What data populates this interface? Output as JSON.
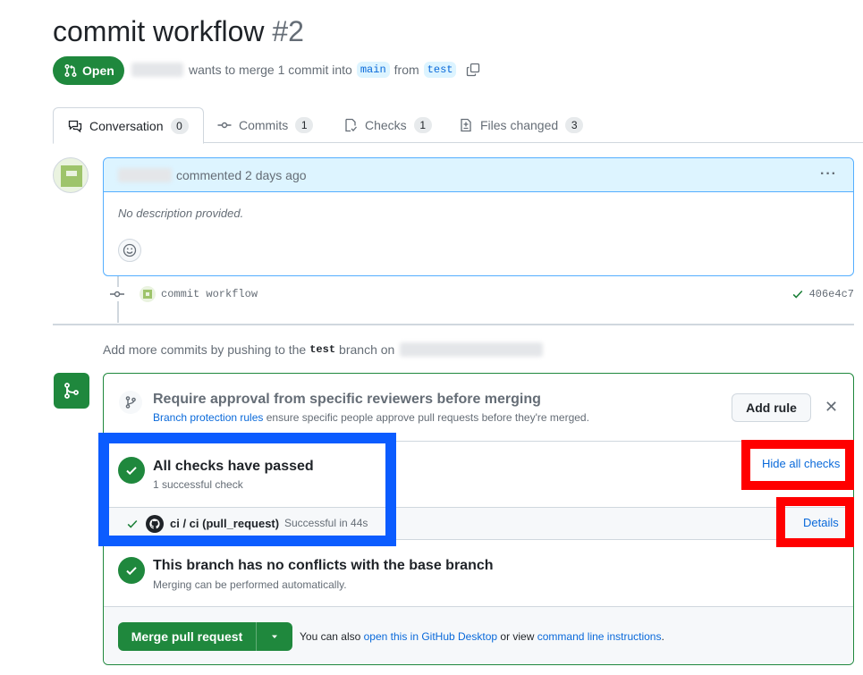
{
  "pr": {
    "title": "commit workflow",
    "number": "#2",
    "state": "Open",
    "merge_text": "wants to merge 1 commit into",
    "base_branch": "main",
    "from_text": "from",
    "head_branch": "test"
  },
  "tabs": [
    {
      "label": "Conversation",
      "count": "0",
      "icon": "comment-discussion-icon"
    },
    {
      "label": "Commits",
      "count": "1",
      "icon": "git-commit-icon"
    },
    {
      "label": "Checks",
      "count": "1",
      "icon": "checklist-icon"
    },
    {
      "label": "Files changed",
      "count": "3",
      "icon": "file-diff-icon"
    }
  ],
  "comment": {
    "action": "commented 2 days ago",
    "body": "No description provided.",
    "more": "···"
  },
  "commit": {
    "message": "commit workflow",
    "sha": "406e4c7"
  },
  "push_note": {
    "prefix": "Add more commits by pushing to the",
    "branch": "test",
    "suffix": "branch on"
  },
  "merge_box": {
    "protection": {
      "title": "Require approval from specific reviewers before merging",
      "link": "Branch protection rules",
      "sub": "ensure specific people approve pull requests before they're merged.",
      "button": "Add rule",
      "close": "✕"
    },
    "checks": {
      "title": "All checks have passed",
      "sub": "1 successful check",
      "toggle": "Hide all checks"
    },
    "ci": {
      "name": "ci / ci (pull_request)",
      "status": "Successful in 44s",
      "details": "Details"
    },
    "conflicts": {
      "title": "This branch has no conflicts with the base branch",
      "sub": "Merging can be performed automatically."
    },
    "merge": {
      "button": "Merge pull request",
      "note_prefix": "You can also",
      "desktop_link": "open this in GitHub Desktop",
      "note_mid": "or view",
      "cli_link": "command line instructions",
      "note_end": "."
    }
  },
  "colors": {
    "success": "#1f883d",
    "link": "#0969da",
    "annotation_blue": "#0b5cff",
    "annotation_red": "#ff0000"
  }
}
